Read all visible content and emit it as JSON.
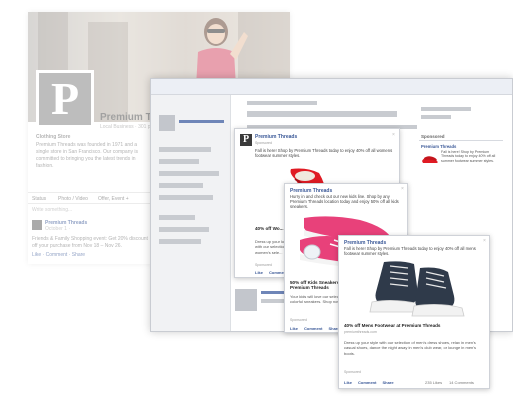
{
  "background_page": {
    "page_name": "Premium Threads",
    "category": "Local Business · 301 people talking about this",
    "about_title": "Clothing Store",
    "about_text": "Premium Threads was founded in 1971 and a single store in San Francisco. Our company is committed to bringing you the latest trends in fashion.",
    "tabs": [
      "Status",
      "Photo / Video",
      "Offer, Event +"
    ],
    "compose_placeholder": "Write something...",
    "post_author": "Premium Threads",
    "post_time": "October 1 · ",
    "post_text": "Friends & Family Shopping event: Get 20% discount off your purchase from Nov 18 – Nov 26.",
    "post_actions": "Like · Comment · Share"
  },
  "newsfeed_ad": {
    "brand": "Premium Threads",
    "sponsored": "Sponsored",
    "text": "Fall is here! Shop by Premium Threads today to enjoy 40% off all womens footwear summer styles.",
    "title": "40% off Wo...",
    "desc": "Dress up your look with our selection of women's sele...",
    "sponsored_footer": "Sponsored",
    "actions": [
      "Like",
      "Comment",
      "Share"
    ]
  },
  "sidebar_ad": {
    "header": "Sponsored",
    "brand": "Premium Threads",
    "text": "Fall is here! Shop by Premium Threads today to enjoy 40% off all summer footwear summer styles."
  },
  "kids_ad": {
    "brand": "Premium Threads",
    "text": "Hurry in and check out our new kids line. Shop by any Premium Threads location today and enjoy 50% off all kids sneakers.",
    "title": "50% off Kids Sneakers at Premium Threads",
    "desc": "Your kids will love our selection of colorful sneakers. Shop now at...",
    "sponsored_footer": "Sponsored",
    "actions": [
      "Like",
      "Comment",
      "Share"
    ]
  },
  "mens_ad": {
    "brand": "Premium Threads",
    "text": "Fall is here! Shop by Premium Threads today to enjoy 40% off all mens footwear summer styles.",
    "title": "40% off Mens Footwear at Premium Threads",
    "url": "premiumthreads.com",
    "desc": "Dress up your style with our selection of men's dress shoes, relax in men's casual shoes, dance the night away in men's club wear, or lounge in men's boots.",
    "sponsored_footer": "Sponsored",
    "actions": [
      "Like",
      "Comment",
      "Share"
    ],
    "likes": "235 Likes",
    "comments": "14 Comments"
  },
  "colors": {
    "facebook_blue": "#3b5998",
    "red_shoe": "#e01b24",
    "pink_sneaker": "#e8417a",
    "dark_sneaker": "#2f3a4a"
  }
}
